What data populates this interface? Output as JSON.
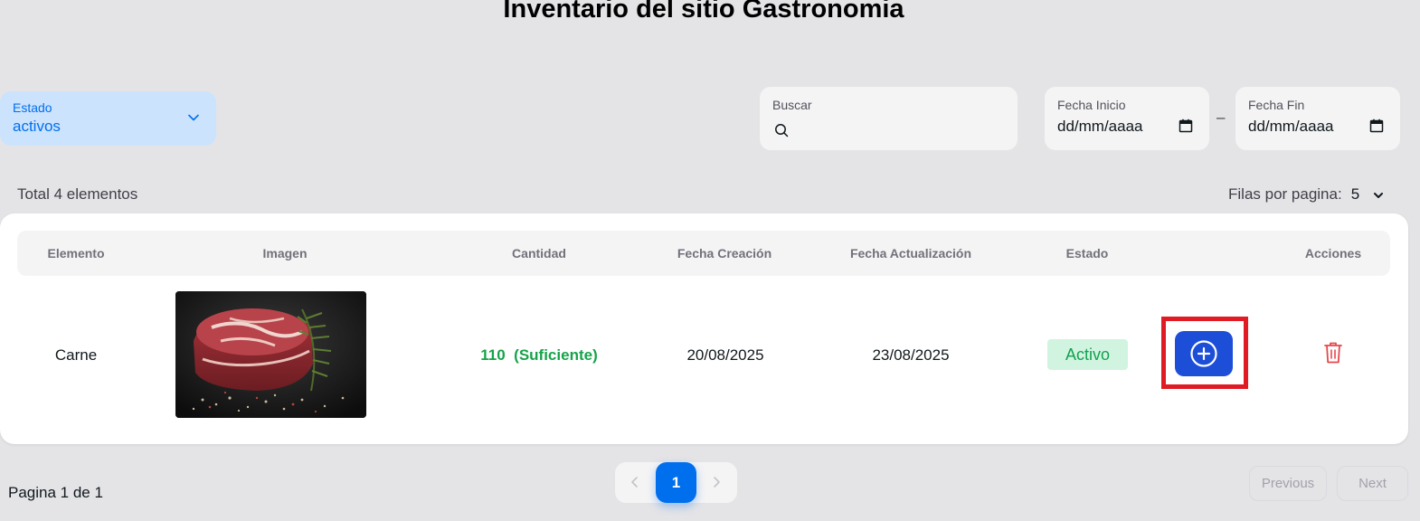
{
  "page": {
    "title": "Inventario del sitio Gastronomia"
  },
  "filters": {
    "estado": {
      "label": "Estado",
      "value": "activos"
    },
    "search": {
      "label": "Buscar",
      "value": ""
    },
    "fecha_inicio": {
      "label": "Fecha Inicio",
      "value": "dd/mm/aaaa"
    },
    "fecha_fin": {
      "label": "Fecha Fin",
      "value": "dd/mm/aaaa"
    },
    "separator": "–"
  },
  "summary": {
    "total": "Total 4 elementos",
    "rows_per_page_label": "Filas por pagina:",
    "rows_per_page_value": "5"
  },
  "table": {
    "headers": [
      "Elemento",
      "Imagen",
      "Cantidad",
      "Fecha Creación",
      "Fecha Actualización",
      "Estado",
      "Acciones"
    ],
    "rows": [
      {
        "elemento": "Carne",
        "cantidad": "110",
        "cantidad_status": "(Suficiente)",
        "fecha_creacion": "20/08/2025",
        "fecha_actualizacion": "23/08/2025",
        "estado": "Activo"
      }
    ]
  },
  "pagination": {
    "info": "Pagina 1 de 1",
    "current_page": "1",
    "previous_label": "Previous",
    "next_label": "Next"
  },
  "colors": {
    "primary": "#006fee",
    "add_button": "#1d4ed8",
    "highlight": "#e01b24",
    "success": "#12a150",
    "danger": "#e5484d"
  }
}
